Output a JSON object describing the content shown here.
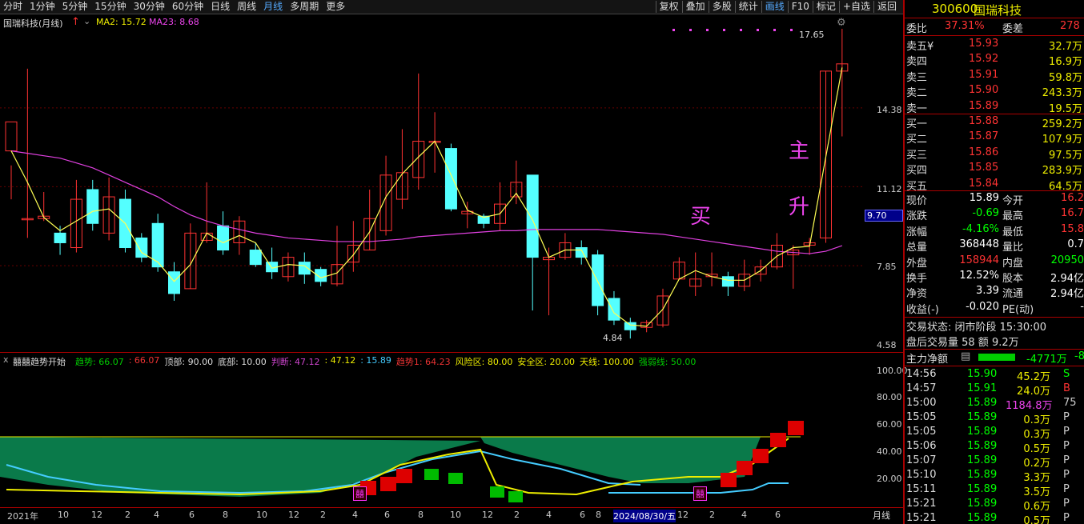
{
  "toolbar": {
    "left": [
      "分时",
      "1分钟",
      "5分钟",
      "15分钟",
      "30分钟",
      "60分钟",
      "日线",
      "周线",
      "月线",
      "多周期",
      "更多"
    ],
    "right": [
      "复权",
      "叠加",
      "多股",
      "统计",
      "画线",
      "F10",
      "标记",
      "+自选",
      "返回"
    ]
  },
  "main": {
    "title": "国瑞科技(月线)",
    "ma2": "MA2: 15.72",
    "ma23": "MA23: 8.68",
    "yticks": [
      "14.38",
      "11.12",
      "7.85",
      "4.58"
    ],
    "price_tag": "9.70",
    "high_label": "17.65",
    "low_label": "4.84",
    "buy_text": "买",
    "main_text": "主",
    "up_text": "升"
  },
  "indicator": {
    "name": "囍囍趋势开始",
    "items": [
      {
        "t": "趋势: 66.07",
        "c": "#0c0"
      },
      {
        "t": ": 66.07",
        "c": "#e33"
      },
      {
        "t": "顶部: 90.00",
        "c": "#ddd"
      },
      {
        "t": "底部: 10.00",
        "c": "#ddd"
      },
      {
        "t": "判断: 47.12",
        "c": "#c4c"
      },
      {
        "t": ": 47.12",
        "c": "#ee0"
      },
      {
        "t": ": 15.89",
        "c": "#4cf"
      },
      {
        "t": "趋势1: 64.23",
        "c": "#e33"
      },
      {
        "t": "风险区: 80.00",
        "c": "#ee0"
      },
      {
        "t": "安全区: 20.00",
        "c": "#ee0"
      },
      {
        "t": "天线: 100.00",
        "c": "#ee0"
      },
      {
        "t": "强弱线: 50.00",
        "c": "#0c0"
      }
    ],
    "yticks": [
      "100.00",
      "80.00",
      "60.00",
      "40.00",
      "20.00"
    ],
    "mark": "囍"
  },
  "xaxis": {
    "labels": [
      [
        "2021年",
        5
      ],
      [
        "10",
        68
      ],
      [
        "12",
        110
      ],
      [
        "2",
        152
      ],
      [
        "4",
        188
      ],
      [
        "6",
        232
      ],
      [
        "8",
        274
      ],
      [
        "10",
        316
      ],
      [
        "12",
        356
      ],
      [
        "2",
        396
      ],
      [
        "4",
        436
      ],
      [
        "6",
        476
      ],
      [
        "8",
        518
      ],
      [
        "10",
        558
      ],
      [
        "12",
        598
      ],
      [
        "2",
        638
      ],
      [
        "4",
        678
      ],
      [
        "6",
        720
      ],
      [
        "8",
        740
      ],
      [
        "2024/08/30/五",
        762
      ],
      [
        "12",
        842
      ],
      [
        "2",
        882
      ],
      [
        "4",
        922
      ],
      [
        "6",
        964
      ]
    ],
    "period": "月线"
  },
  "right_panel": {
    "code": "300600",
    "name": "国瑞科技",
    "weibi_label": "委比",
    "weibi": "37.31%",
    "weicha_label": "委差",
    "weicha": "278",
    "asks": [
      [
        "卖五¥",
        "15.93",
        "32.7万"
      ],
      [
        "卖四",
        "15.92",
        "16.9万"
      ],
      [
        "卖三",
        "15.91",
        "59.8万"
      ],
      [
        "卖二",
        "15.90",
        "243.3万"
      ],
      [
        "卖一",
        "15.89",
        "19.5万"
      ]
    ],
    "bids": [
      [
        "买一",
        "15.88",
        "259.2万"
      ],
      [
        "买二",
        "15.87",
        "107.9万"
      ],
      [
        "买三",
        "15.86",
        "97.5万"
      ],
      [
        "买四",
        "15.85",
        "283.9万"
      ],
      [
        "买五",
        "15.84",
        "64.5万"
      ]
    ],
    "stats": [
      [
        "现价",
        "15.89",
        "今开",
        "16.2"
      ],
      [
        "涨跌",
        "-0.69",
        "最高",
        "16.7"
      ],
      [
        "涨幅",
        "-4.16%",
        "最低",
        "15.8"
      ],
      [
        "总量",
        "368448",
        "量比",
        "0.7"
      ],
      [
        "外盘",
        "158944",
        "内盘",
        "20950"
      ],
      [
        "换手",
        "12.52%",
        "股本",
        "2.94亿"
      ],
      [
        "净资",
        "3.39",
        "流通",
        "2.94亿"
      ],
      [
        "收益(-)",
        "-0.020",
        "PE(动)",
        "-"
      ]
    ],
    "status": "交易状态: 闭市阶段 15:30:00",
    "after": "盘后交易量 58 额 9.2万",
    "flow_label": "主力净额",
    "flow_value": "-4771万",
    "flow_extra": "-8",
    "ticks": [
      [
        "14:56",
        "15.90",
        "45.2万",
        "S"
      ],
      [
        "14:57",
        "15.91",
        "24.0万",
        "B"
      ],
      [
        "15:00",
        "15.89",
        "1184.8万",
        "75"
      ],
      [
        "15:05",
        "15.89",
        "0.3万",
        "P"
      ],
      [
        "15:05",
        "15.89",
        "0.3万",
        "P"
      ],
      [
        "15:06",
        "15.89",
        "0.5万",
        "P"
      ],
      [
        "15:07",
        "15.89",
        "0.2万",
        "P"
      ],
      [
        "15:10",
        "15.89",
        "3.3万",
        "P"
      ],
      [
        "15:11",
        "15.89",
        "3.5万",
        "P"
      ],
      [
        "15:21",
        "15.89",
        "0.6万",
        "P"
      ],
      [
        "15:21",
        "15.89",
        "0.5万",
        "P"
      ]
    ]
  },
  "colors": {
    "up": "#ff3232",
    "down": "#54ffff",
    "ma2": "#ffff54",
    "ma23": "#e040e0",
    "bg": "#000000"
  },
  "chart_data": {
    "type": "candlestick",
    "title": "国瑞科技(月线)",
    "ylim": [
      4.58,
      17.65
    ],
    "candles": [
      [
        12.6,
        13.8,
        12.0,
        10.6
      ],
      [
        9.8,
        9.8,
        16.0,
        9.0
      ],
      [
        9.8,
        9.9,
        10.9,
        9.7
      ],
      [
        9.2,
        8.8,
        9.5,
        8.3
      ],
      [
        8.6,
        10.6,
        11.4,
        8.4
      ],
      [
        11.0,
        9.6,
        11.4,
        9.3
      ],
      [
        9.2,
        10.7,
        11.5,
        8.9
      ],
      [
        10.6,
        8.6,
        11.0,
        8.4
      ],
      [
        9.0,
        8.2,
        9.2,
        8.0
      ],
      [
        9.6,
        7.8,
        10.0,
        7.6
      ],
      [
        7.6,
        6.7,
        8.0,
        6.4
      ],
      [
        6.9,
        9.2,
        9.6,
        6.9
      ],
      [
        8.9,
        9.2,
        11.3,
        8.8
      ],
      [
        9.5,
        8.5,
        10.1,
        8.3
      ],
      [
        8.8,
        9.7,
        9.9,
        8.3
      ],
      [
        8.5,
        7.9,
        8.8,
        7.8
      ],
      [
        8.0,
        7.6,
        8.6,
        7.3
      ],
      [
        7.4,
        8.2,
        8.4,
        7.2
      ],
      [
        8.0,
        7.5,
        8.4,
        7.1
      ],
      [
        7.7,
        7.2,
        7.8,
        7.0
      ],
      [
        7.1,
        7.9,
        9.5,
        7.0
      ],
      [
        8.0,
        8.7,
        9.7,
        7.6
      ],
      [
        8.5,
        9.8,
        11.0,
        8.5
      ],
      [
        9.3,
        11.6,
        12.4,
        9.1
      ],
      [
        10.6,
        11.7,
        13.5,
        10.2
      ],
      [
        11.5,
        13.0,
        15.8,
        11.0
      ],
      [
        13.0,
        13.0,
        14.2,
        11.7
      ],
      [
        12.7,
        10.2,
        12.9,
        10.1
      ],
      [
        10.0,
        10.1,
        10.5,
        9.4
      ],
      [
        9.9,
        9.6,
        10.0,
        9.4
      ],
      [
        9.6,
        10.4,
        11.3,
        9.3
      ],
      [
        10.7,
        11.3,
        12.2,
        10.4
      ],
      [
        11.6,
        8.2,
        11.6,
        6.0
      ],
      [
        8.1,
        8.2,
        8.6,
        5.8
      ],
      [
        8.2,
        8.8,
        9.2,
        8.1
      ],
      [
        8.6,
        8.2,
        8.9,
        7.9
      ],
      [
        8.3,
        6.2,
        8.5,
        5.8
      ],
      [
        6.5,
        5.6,
        6.8,
        5.4
      ],
      [
        5.5,
        5.2,
        5.7,
        4.84
      ],
      [
        5.3,
        5.5,
        5.6,
        5.1
      ],
      [
        5.4,
        6.6,
        6.9,
        5.3
      ],
      [
        7.3,
        8.0,
        8.2,
        7.3
      ],
      [
        7.0,
        7.3,
        8.4,
        6.6
      ],
      [
        7.4,
        7.5,
        8.4,
        7.0
      ],
      [
        7.4,
        7.0,
        7.6,
        6.6
      ],
      [
        7.0,
        7.5,
        8.1,
        6.8
      ],
      [
        7.5,
        7.8,
        8.1,
        7.2
      ],
      [
        7.8,
        8.7,
        9.2,
        7.7
      ],
      [
        8.3,
        8.5,
        8.7,
        6.9
      ],
      [
        8.7,
        8.8,
        9.0,
        8.3
      ],
      [
        9.0,
        15.9,
        15.9,
        8.8
      ],
      [
        15.9,
        16.2,
        17.65,
        13.2
      ]
    ],
    "ma2": [
      12.6,
      11.3,
      9.85,
      9.3,
      9.7,
      10.1,
      10.2,
      9.6,
      8.4,
      8.0,
      7.2,
      7.9,
      9.2,
      8.8,
      9.1,
      8.8,
      7.75,
      7.9,
      7.85,
      7.35,
      7.55,
      8.3,
      9.25,
      10.7,
      11.65,
      12.35,
      13.0,
      11.6,
      10.15,
      9.85,
      10.0,
      10.85,
      9.75,
      8.2,
      8.5,
      8.5,
      7.2,
      5.9,
      5.4,
      5.35,
      6.05,
      7.3,
      7.65,
      7.4,
      7.25,
      7.25,
      7.65,
      8.25,
      8.6,
      8.65,
      12.35,
      16.05
    ],
    "ma23": [
      12.6,
      12.5,
      12.4,
      12.3,
      12.1,
      11.9,
      11.6,
      11.3,
      11.0,
      10.7,
      10.3,
      9.95,
      9.7,
      9.5,
      9.35,
      9.2,
      9.1,
      9.0,
      8.95,
      8.9,
      8.85,
      8.85,
      8.85,
      8.9,
      8.95,
      9.05,
      9.1,
      9.15,
      9.2,
      9.25,
      9.3,
      9.3,
      9.35,
      9.35,
      9.35,
      9.35,
      9.35,
      9.3,
      9.25,
      9.2,
      9.15,
      9.05,
      8.95,
      8.85,
      8.75,
      8.65,
      8.55,
      8.45,
      8.4,
      8.35,
      8.45,
      8.68
    ]
  }
}
